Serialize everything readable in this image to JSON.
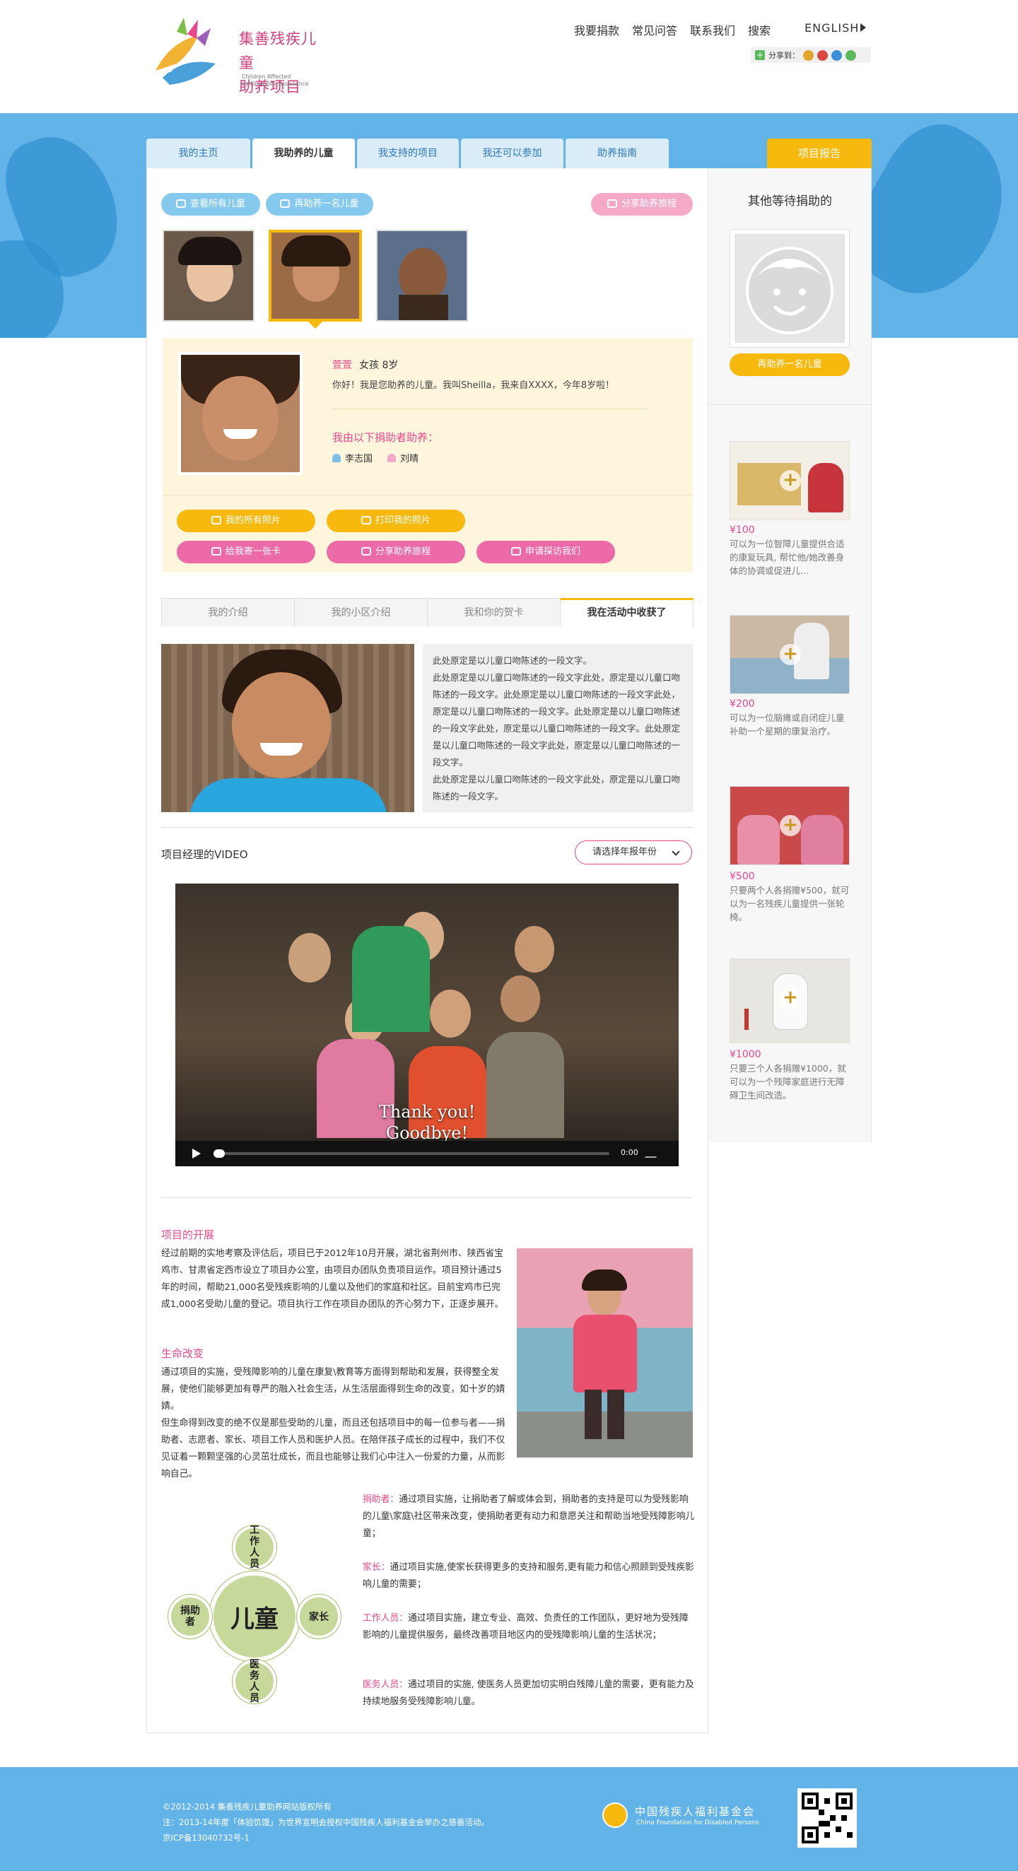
{
  "brand": {
    "title_line1": "集善残疾儿童",
    "title_line2": "助养项目",
    "subtitle_line1": "Children Affected",
    "subtitle_line2": "by Disability Assistance"
  },
  "topnav": [
    "我要捐款",
    "常见问答",
    "联系我们",
    "搜索"
  ],
  "language": "ENGLISH",
  "share_label": "分享到：",
  "tabs": [
    "我的主页",
    "我助养的儿童",
    "我支持的项目",
    "我还可以参加",
    "助养指南"
  ],
  "report_tab": "项目报告",
  "actions": {
    "view_all": "查看所有儿童",
    "sponsor_another": "再助养一名儿童",
    "share_journey": "分享助养旅程"
  },
  "child": {
    "name": "萱萱",
    "gender_age": "女孩  8岁",
    "greeting": "你好！我是您助养的儿童。我叫Sheilla，我来自XXXX，今年8岁啦！",
    "sponsors_title": "我由以下捐助者助养：",
    "sponsors": [
      "李志国",
      "刘晴"
    ]
  },
  "profile_buttons": {
    "all_photos": "我的所有照片",
    "print_photos": "打印我的照片",
    "send_card": "给我寄一张卡",
    "share_journey": "分享助养旅程",
    "apply_visit": "申请探访我们"
  },
  "content_tabs": [
    "我的介绍",
    "我的小区介绍",
    "我和你的贺卡",
    "我在活动中收获了"
  ],
  "story_text": [
    "此处原定是以儿童口吻陈述的一段文字。",
    "此处原定是以儿童口吻陈述的一段文字此处，原定是以儿童口吻陈述的一段文字。此处原定是以儿童口吻陈述的一段文字此处，原定是以儿童口吻陈述的一段文字。此处原定是以儿童口吻陈述的一段文字此处，原定是以儿童口吻陈述的一段文字。此处原定是以儿童口吻陈述的一段文字此处，原定是以儿童口吻陈述的一段文字。",
    "此处原定是以儿童口吻陈述的一段文字此处，原定是以儿童口吻陈述的一段文字。"
  ],
  "video": {
    "title": "项目经理的VIDEO",
    "year_select": "请选择年报年份",
    "caption_line1": "Thank you!",
    "caption_line2": "Goodbye!",
    "time": "0:00"
  },
  "project": {
    "progress_title": "项目的开展",
    "progress_text": "经过前期的实地考察及评估后，项目已于2012年10月开展，湖北省荆州市、陕西省宝鸡市、甘肃省定西市设立了项目办公室，由项目办团队负责项目运作。项目预计通过5年的时间，帮助21,000名受残疾影响的儿童以及他们的家庭和社区。目前宝鸡市已完成1,000名受助儿童的登记。项目执行工作在项目办团队的齐心努力下，正逐步展开。",
    "life_title": "生命改变",
    "life_text1": "通过项目的实施，受残障影响的儿童在康复\\教育等方面得到帮助和发展，获得整全发展，使他们能够更加有尊严的融入社会生活，从生活层面得到生命的改变，如十岁的婧婧。",
    "life_text2": "但生命得到改变的绝不仅是那些受助的儿童，而且还包括项目中的每一位参与者——捐助者、志愿者、家长、项目工作人员和医护人员。在陪伴孩子成长的过程中，我们不仅见证着一颗颗坚强的心灵茁壮成长，而且也能够让我们心中注入一份爱的力量，从而影响自己。"
  },
  "diagram": {
    "center": "儿童",
    "top": "工作人员",
    "left": "捐助者",
    "right": "家长",
    "bottom": "医务人员"
  },
  "roles": [
    {
      "label": "捐助者：",
      "text": "通过项目实施，让捐助者了解或体会到，捐助者的支持是可以为受残影响的儿童\\家庭\\社区带来改变，使捐助者更有动力和意愿关注和帮助当地受残障影响儿童；"
    },
    {
      "label": "家长：",
      "text": "通过项目实施,使家长获得更多的支持和服务,更有能力和信心照顾到受残疾影响儿童的需要；"
    },
    {
      "label": "工作人员：",
      "text": "通过项目实施，建立专业、高效、负责任的工作团队，更好地为受残障影响的儿童提供服务，最终改善项目地区内的受残障影响儿童的生活状况；"
    },
    {
      "label": "医务人员：",
      "text": "通过项目的实施, 使医务人员更加切实明白残障儿童的需要，更有能力及持续地服务受残障影响儿童。"
    }
  ],
  "sidebar": {
    "title": "其他等待捐助的",
    "sponsor_button": "再助养一名儿童",
    "gifts": [
      {
        "price": "¥100",
        "desc": "可以为一位智障儿童提供合适的康复玩具, 帮忙他/她改善身体的协调或促进儿…"
      },
      {
        "price": "¥200",
        "desc": "可以为一位脑瘫或自闭症儿童补助一个星期的康复治疗。"
      },
      {
        "price": "¥500",
        "desc": "只要两个人各捐赠¥500，就可以为一名残疾儿童提供一张轮椅。"
      },
      {
        "price": "¥1000",
        "desc": "只要三个人各捐赠¥1000，就可以为一个残障家庭进行无障碍卫生间改造。"
      }
    ]
  },
  "footer": {
    "copyright": "©2012-2014 集善残疾儿童助养网站版权所有",
    "note": "注：2013-14年度「体验饥饿」为世界宣明会授权中国残疾人福利基金会举办之慈善活动。",
    "icp": "京ICP备13040732号-1",
    "org_cn": "中国残疾人福利基金会",
    "org_en": "China Foundation for Disabled Persons"
  },
  "colors": {
    "blue_band": "#62b4e8",
    "accent_yellow": "#f8b90f",
    "accent_pink": "#e8478b",
    "tab_blue": "#2d78b6"
  }
}
